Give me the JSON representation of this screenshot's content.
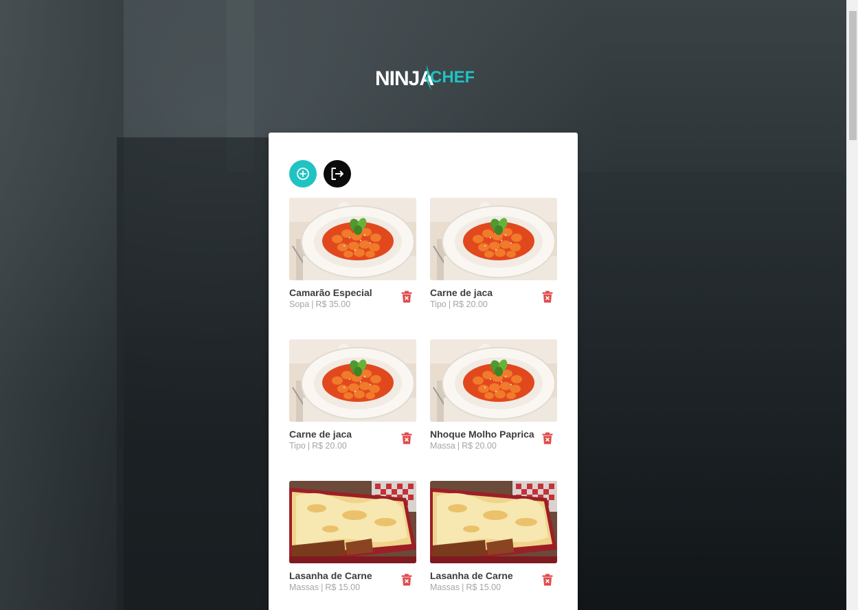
{
  "brand": {
    "logo_part1": "NINJA",
    "logo_part2": "CHEF"
  },
  "actions": {
    "add_icon": "plus-circle-icon",
    "logout_icon": "logout-icon"
  },
  "colors": {
    "accent": "#1fc3c2",
    "delete": "#e04b4b",
    "dark_button": "#0b0b0b"
  },
  "separator": "|",
  "items": [
    {
      "name": "Camarão Especial",
      "category": "Sopa",
      "price": "R$ 35.00",
      "image": "gnocchi-tomato"
    },
    {
      "name": "Carne de jaca",
      "category": "Tipo",
      "price": "R$ 20.00",
      "image": "gnocchi-tomato"
    },
    {
      "name": "Carne de jaca",
      "category": "Tipo",
      "price": "R$ 20.00",
      "image": "gnocchi-tomato"
    },
    {
      "name": "Nhoque Molho Paprica",
      "category": "Massa",
      "price": "R$ 20.00",
      "image": "gnocchi-tomato"
    },
    {
      "name": "Lasanha de Carne",
      "category": "Massas",
      "price": "R$ 15.00",
      "image": "lasagna"
    },
    {
      "name": "Lasanha de Carne",
      "category": "Massas",
      "price": "R$ 15.00",
      "image": "lasagna"
    }
  ]
}
